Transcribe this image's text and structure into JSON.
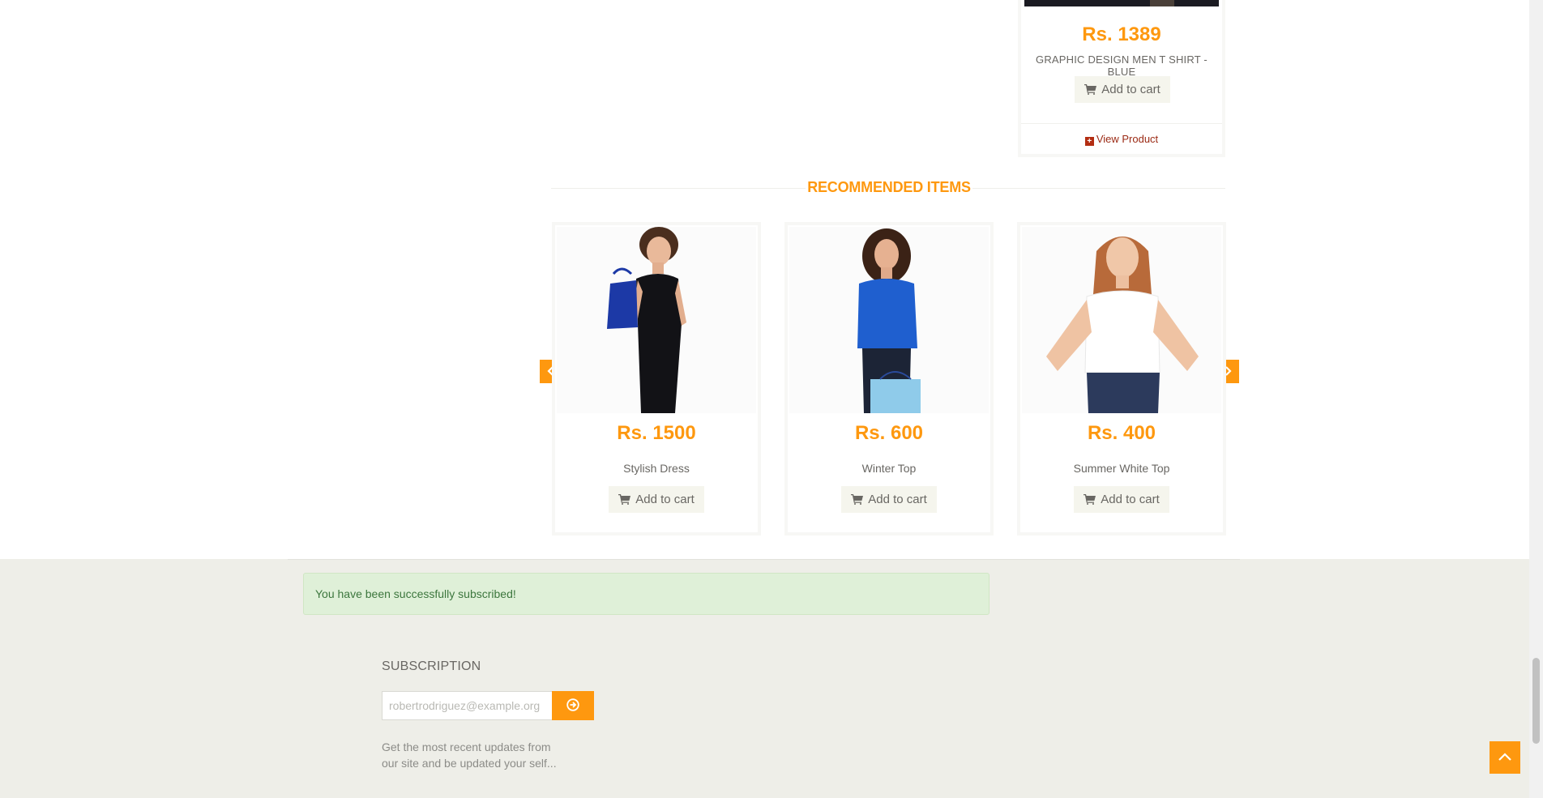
{
  "top_product": {
    "price": "Rs. 1389",
    "name": "GRAPHIC DESIGN MEN T SHIRT - BLUE",
    "add_to_cart_label": "Add to cart",
    "view_product_label": "View Product"
  },
  "recommended": {
    "title": "RECOMMENDED ITEMS",
    "items": [
      {
        "price": "Rs. 1500",
        "name": "Stylish Dress",
        "add_to_cart_label": "Add to cart"
      },
      {
        "price": "Rs. 600",
        "name": "Winter Top",
        "add_to_cart_label": "Add to cart"
      },
      {
        "price": "Rs. 400",
        "name": "Summer White Top",
        "add_to_cart_label": "Add to cart"
      }
    ],
    "prev_icon": "chevron-left-icon",
    "next_icon": "chevron-right-icon"
  },
  "footer": {
    "alert_text": "You have been successfully subscribed!",
    "subscription_title": "SUBSCRIPTION",
    "email_placeholder": "robertrodriguez@example.org",
    "subscribe_icon": "arrow-circle-right-icon",
    "description_line1": "Get the most recent updates from",
    "description_line2": "our site and be updated your self..."
  },
  "scroll_up_icon": "chevron-up-icon",
  "colors": {
    "accent": "#FE980F",
    "footer_bg": "#EEEEE8",
    "alert_bg": "#dff0d8",
    "alert_text": "#3c763d",
    "view_product": "#9b2a14"
  }
}
